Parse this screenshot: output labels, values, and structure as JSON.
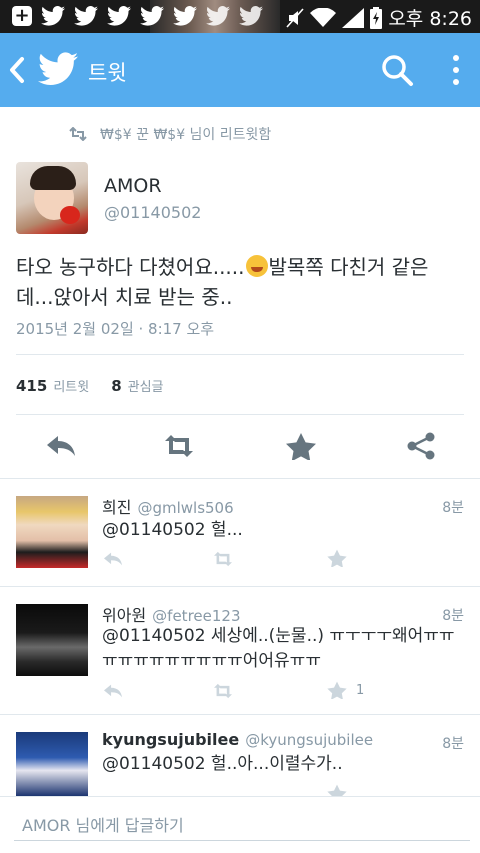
{
  "status_bar": {
    "time": "오후 8:26"
  },
  "app_bar": {
    "title": "트윗"
  },
  "retweet_context": {
    "text": "₩$¥ 꾼 ₩$¥ 님이 리트윗함"
  },
  "tweet": {
    "author_name": "AMOR",
    "author_handle": "@01140502",
    "text_part1": "타오 농구하다 다쳤어요.....",
    "text_part2": "발목쪽 다친거 같은데...앉아서 치료 받는 중..",
    "date": "2015년 2월 02일 · 8:17 오후",
    "retweets_count": "415",
    "retweets_label": "리트윗",
    "favorites_count": "8",
    "favorites_label": "관심글"
  },
  "replies": [
    {
      "name": "희진",
      "handle": "@gmlwls506",
      "time": "8분",
      "text": "@01140502 헐...",
      "fav_count": ""
    },
    {
      "name": "위아원",
      "handle": "@fetree123",
      "time": "8분",
      "text": "@01140502 세상에..(눈물..) ㅠㅜㅜㅜ왜어ㅠㅠㅠㅠㅠㅠㅠㅠㅠㅠㅠ어어유ㅠㅠ",
      "fav_count": "1"
    },
    {
      "name": "kyungsujubilee",
      "handle": "@kyungsujubilee",
      "time": "8분",
      "text": "@01140502 헐..아...이렬수가..",
      "fav_count": ""
    }
  ],
  "compose": {
    "placeholder": "AMOR 님에게 답글하기"
  },
  "colors": {
    "brand": "#55acee",
    "muted": "#8899a6",
    "text": "#292f33",
    "divider": "#e1e8ed"
  }
}
